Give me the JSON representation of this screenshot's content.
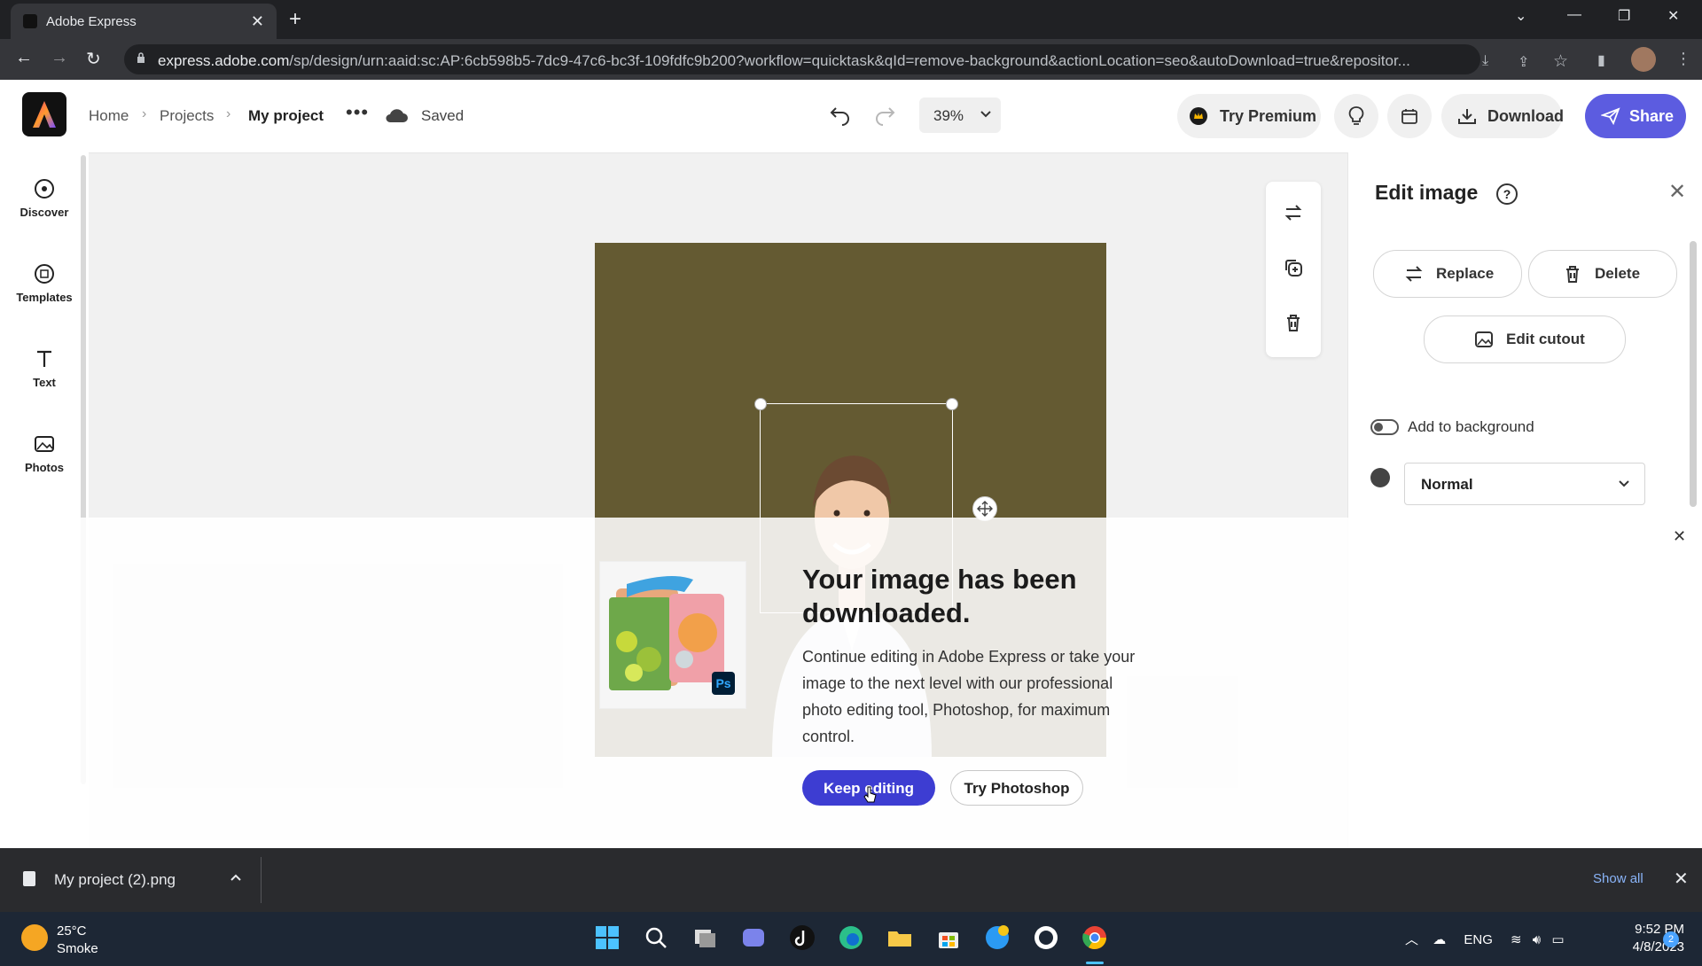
{
  "browser": {
    "tab_title": "Adobe Express",
    "url_host": "express.adobe.com",
    "url_path": "/sp/design/urn:aaid:sc:AP:6cb598b5-7dc9-47c6-bc3f-109fdfc9b200?workflow=quicktask&qId=remove-background&actionLocation=seo&autoDownload=true&repositor..."
  },
  "header": {
    "breadcrumb": [
      "Home",
      "Projects",
      "My project"
    ],
    "save_status": "Saved",
    "zoom": "39%",
    "try_premium": "Try Premium",
    "download": "Download",
    "share": "Share"
  },
  "left_rail": {
    "items": [
      {
        "label": "Discover",
        "icon": "discover-icon"
      },
      {
        "label": "Templates",
        "icon": "templates-icon"
      },
      {
        "label": "Text",
        "icon": "text-icon"
      },
      {
        "label": "Photos",
        "icon": "photos-icon"
      }
    ]
  },
  "right_panel": {
    "title": "Edit image",
    "replace": "Replace",
    "delete": "Delete",
    "edit_cutout": "Edit cutout",
    "add_to_background": "Add to background",
    "add_to_background_on": false,
    "blend_mode": "Normal"
  },
  "dialog": {
    "title": "Your image has been downloaded.",
    "body": "Continue editing in Adobe Express or take your image to the next level with our professional photo editing tool, Photoshop, for maximum control.",
    "keep_editing": "Keep editing",
    "try_photoshop": "Try Photoshop",
    "ps_badge": "Ps"
  },
  "download_bar": {
    "filename": "My project (2).png",
    "show_all": "Show all"
  },
  "taskbar": {
    "temperature": "25°C",
    "condition": "Smoke",
    "language": "ENG",
    "time": "9:52 PM",
    "date": "4/8/2023",
    "notifications": "2"
  },
  "colors": {
    "artboard": "#645a32",
    "share": "#5c5ce0",
    "keep_editing": "#3d3dd2"
  }
}
